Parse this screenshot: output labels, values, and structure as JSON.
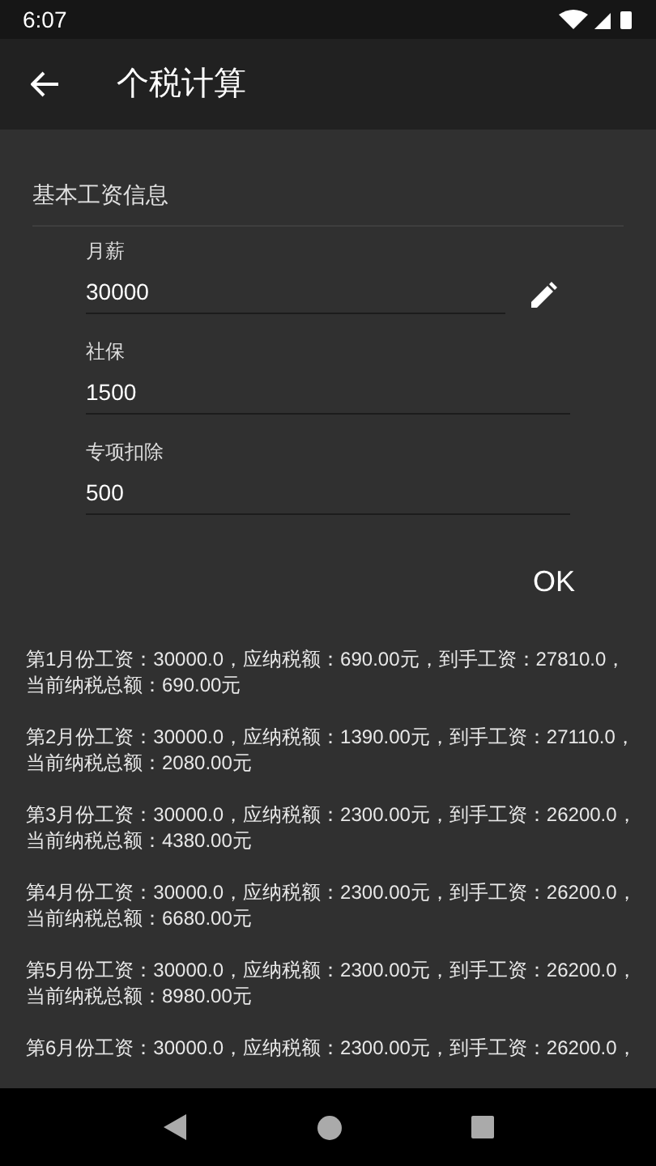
{
  "status_bar": {
    "time": "6:07"
  },
  "app_bar": {
    "title": "个税计算"
  },
  "section": {
    "title": "基本工资信息"
  },
  "fields": [
    {
      "label": "月薪",
      "value": "30000",
      "editable": true
    },
    {
      "label": "社保",
      "value": "1500",
      "editable": false
    },
    {
      "label": "专项扣除",
      "value": "500",
      "editable": false
    }
  ],
  "ok_button": "OK",
  "results": [
    {
      "lines": [
        "第1月份工资：30000.0，应纳税额：690.00元，到手工资：27810.0，",
        "当前纳税总额：690.00元"
      ]
    },
    {
      "lines": [
        "第2月份工资：30000.0，应纳税额：1390.00元，到手工资：27110.0，",
        "当前纳税总额：2080.00元"
      ]
    },
    {
      "lines": [
        "第3月份工资：30000.0，应纳税额：2300.00元，到手工资：26200.0，",
        "当前纳税总额：4380.00元"
      ]
    },
    {
      "lines": [
        "第4月份工资：30000.0，应纳税额：2300.00元，到手工资：26200.0，",
        "当前纳税总额：6680.00元"
      ]
    },
    {
      "lines": [
        "第5月份工资：30000.0，应纳税额：2300.00元，到手工资：26200.0，",
        "当前纳税总额：8980.00元"
      ]
    },
    {
      "lines": [
        "第6月份工资：30000.0，应纳税额：2300.00元，到手工资：26200.0，"
      ]
    }
  ]
}
